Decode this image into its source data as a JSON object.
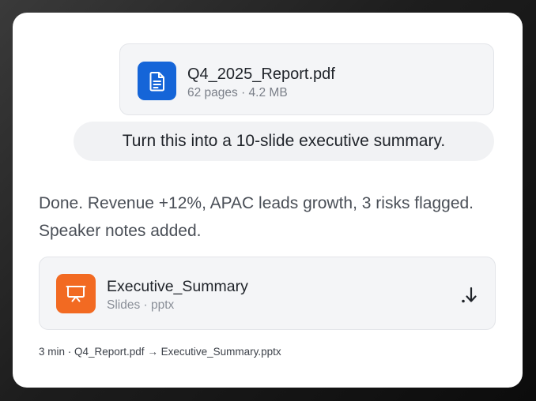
{
  "attachment": {
    "icon": "document-icon",
    "name": "Q4_2025_Report.pdf",
    "meta": "62 pages · 4.2 MB",
    "color": "#1565d8"
  },
  "user_message": "Turn this into a 10-slide executive summary.",
  "assistant_message": "Done. Revenue +12%, APAC leads growth, 3 risks flagged. Speaker notes added.",
  "output_file": {
    "icon": "presentation-icon",
    "name": "Executive_Summary",
    "meta": "Slides · pptx",
    "action_icon": "download-icon",
    "color": "#f26a22"
  },
  "footer": {
    "status": "3 min · Q4_Report.pdf → Executive_Summary.pptx"
  }
}
